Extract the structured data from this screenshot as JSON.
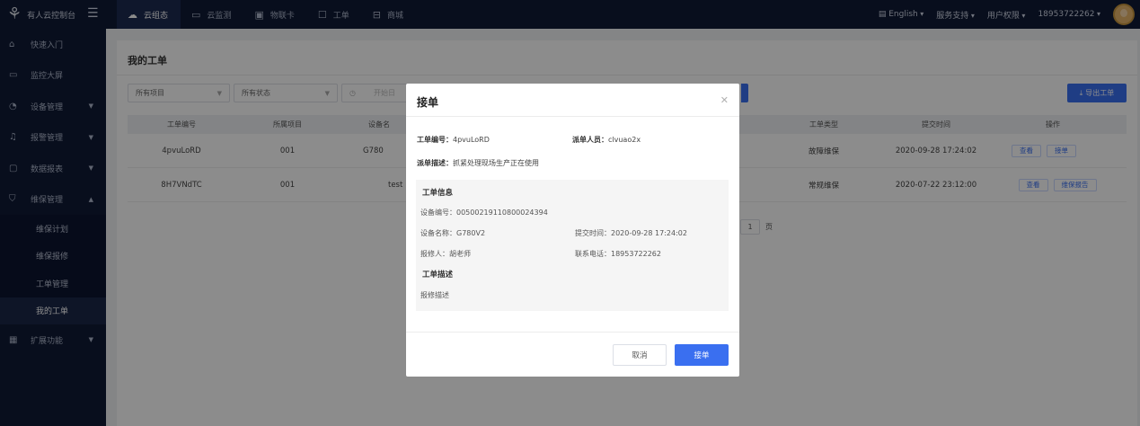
{
  "brand": {
    "title": "有人云控制台",
    "logo_icon": "person-logo-icon",
    "menu_icon": "hamburger-icon"
  },
  "nav": [
    {
      "label": "云组态",
      "icon": "cloud-icon",
      "active": true
    },
    {
      "label": "云监测",
      "icon": "monitor-icon",
      "active": false
    },
    {
      "label": "物联卡",
      "icon": "sim-card-icon",
      "active": false
    },
    {
      "label": "工单",
      "icon": "ticket-icon",
      "active": false
    },
    {
      "label": "商城",
      "icon": "shop-icon",
      "active": false
    }
  ],
  "topright": {
    "language": "English",
    "support": "服务支持",
    "permission": "用户权限",
    "account": "18953722262"
  },
  "sidebar": {
    "items": [
      {
        "label": "快速入门",
        "icon": "home-icon"
      },
      {
        "label": "监控大屏",
        "icon": "screen-icon"
      },
      {
        "label": "设备管理",
        "icon": "device-icon"
      },
      {
        "label": "报警管理",
        "icon": "bell-icon"
      },
      {
        "label": "数据报表",
        "icon": "report-icon"
      },
      {
        "label": "维保管理",
        "icon": "shield-icon"
      }
    ],
    "sub": [
      {
        "label": "维保计划"
      },
      {
        "label": "维保报修"
      },
      {
        "label": "工单管理"
      },
      {
        "label": "我的工单"
      }
    ],
    "extra": {
      "label": "扩展功能",
      "icon": "grid-icon"
    }
  },
  "main": {
    "title": "我的工单",
    "filters": {
      "project": "所有项目",
      "status": "所有状态",
      "date_start": "开始日"
    },
    "export_label": "导出工单",
    "columns": {
      "id": "工单编号",
      "project": "所属项目",
      "device": "设备名",
      "type": "工单类型",
      "time": "提交时间",
      "op": "操作"
    },
    "rows": [
      {
        "id": "4pvuLoRD",
        "project": "001",
        "device": "G780",
        "type": "故障维保",
        "time": "2020-09-28 17:24:02",
        "op1": "查看",
        "op2": "接单"
      },
      {
        "id": "8H7VNdTC",
        "project": "001",
        "device": "test",
        "type": "常规维保",
        "time": "2020-07-22 23:12:00",
        "op1": "查看",
        "op2": "维保报告"
      }
    ],
    "pager": {
      "page": "1",
      "unit": "页"
    }
  },
  "modal": {
    "title": "接单",
    "order_id_label": "工单编号：",
    "order_id": "4pvuLoRD",
    "dispatcher_label": "派单人员：",
    "dispatcher": "clvuao2x",
    "dispatch_desc_label": "派单描述：",
    "dispatch_desc": "抓紧处理现场生产正在使用",
    "info_title": "工单信息",
    "device_no": "设备编号：00500219110800024394",
    "device_name": "设备名称：G780V2",
    "submit_time": "提交时间：2020-09-28 17:24:02",
    "reporter": "报修人：胡老师",
    "phone": "联系电话：18953722262",
    "desc_title": "工单描述",
    "desc": "报修描述",
    "cancel": "取消",
    "accept": "接单"
  },
  "colors": {
    "accent": "#3a6ff0",
    "nav_bg": "#0f1a35"
  }
}
